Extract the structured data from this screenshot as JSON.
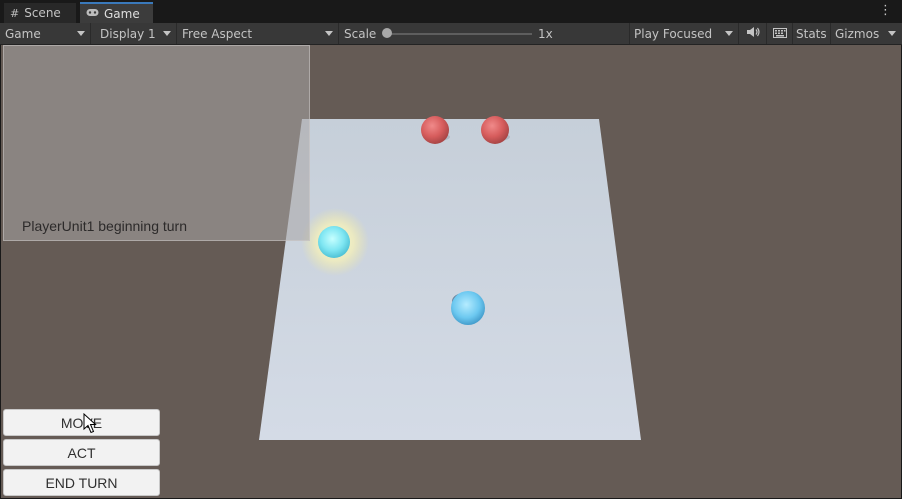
{
  "tabs": [
    {
      "label": "Scene",
      "icon": "grid-icon"
    },
    {
      "label": "Game",
      "icon": "gamepad-icon"
    }
  ],
  "toolbar": {
    "mode": "Game",
    "display": "Display 1",
    "aspect": "Free Aspect",
    "scale_label": "Scale",
    "scale_value": "1x",
    "play_mode": "Play Focused",
    "stats": "Stats",
    "gizmos": "Gizmos"
  },
  "game": {
    "log_message": "PlayerUnit1 beginning turn",
    "buttons": {
      "move": "MOVE",
      "act": "ACT",
      "end_turn": "END TURN"
    }
  }
}
